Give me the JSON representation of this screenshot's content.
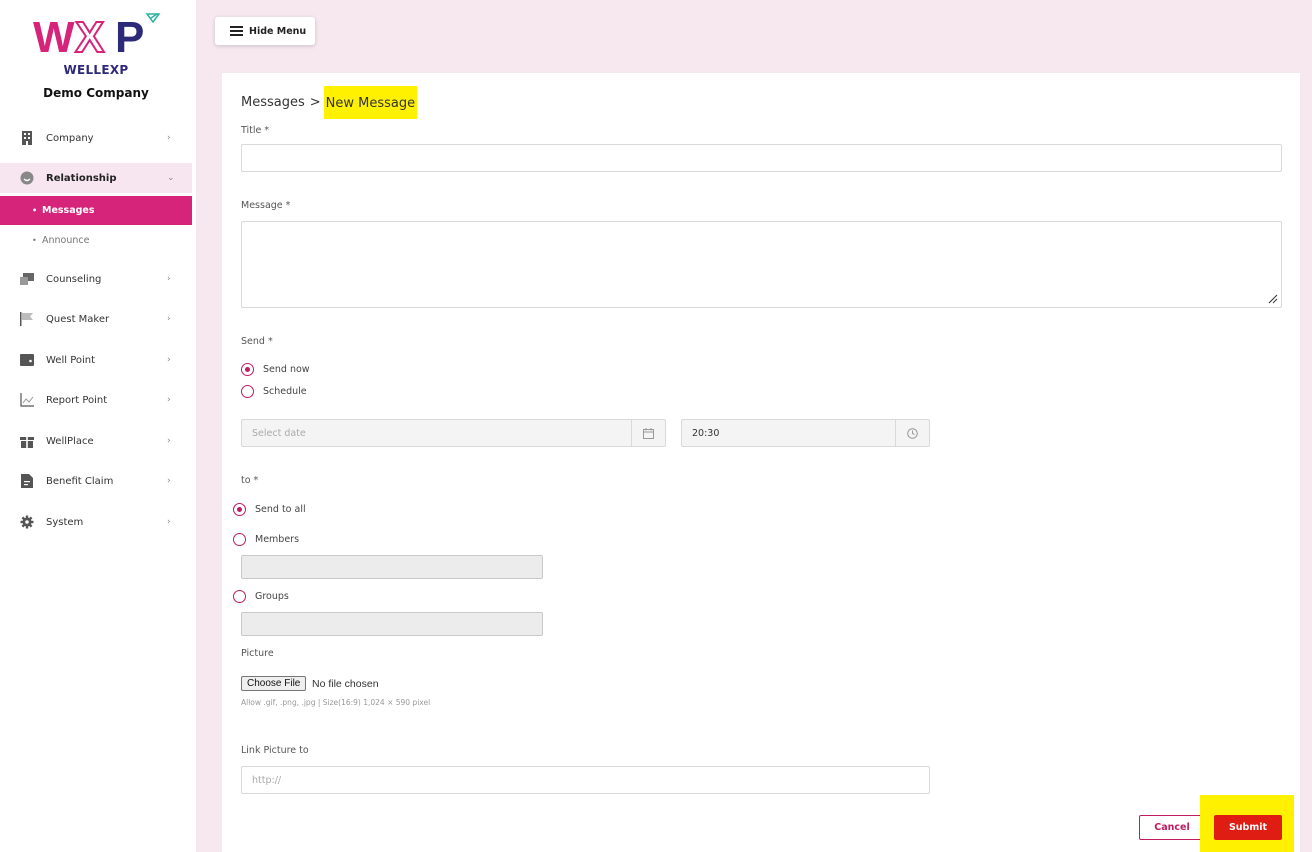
{
  "brand": {
    "logo_text": "WXP",
    "name": "WELLEXP",
    "company": "Demo Company"
  },
  "toolbar": {
    "hide_menu_label": "Hide Menu"
  },
  "sidebar": {
    "items": [
      {
        "label": "Company",
        "icon": "building-icon"
      },
      {
        "label": "Relationship",
        "icon": "relationship-icon"
      },
      {
        "label": "Counseling",
        "icon": "counseling-icon"
      },
      {
        "label": "Quest Maker",
        "icon": "flag-icon"
      },
      {
        "label": "Well Point",
        "icon": "wallet-icon"
      },
      {
        "label": "Report Point",
        "icon": "chart-icon"
      },
      {
        "label": "WellPlace",
        "icon": "gift-icon"
      },
      {
        "label": "Benefit Claim",
        "icon": "document-icon"
      },
      {
        "label": "System",
        "icon": "gear-icon"
      }
    ],
    "sub_items": [
      {
        "label": "Messages"
      },
      {
        "label": "Announce"
      }
    ]
  },
  "breadcrumb": {
    "parent": "Messages",
    "separator": ">",
    "current": "New Message"
  },
  "form": {
    "title_label": "Title *",
    "title_value": "",
    "message_label": "Message *",
    "message_value": "",
    "send_label": "Send *",
    "send_options": [
      "Send now",
      "Schedule"
    ],
    "send_selected": "Send now",
    "date_placeholder": "Select date",
    "time_value": "20:30",
    "to_label": "to *",
    "to_options": [
      "Send to all",
      "Members",
      "Groups"
    ],
    "to_selected": "Send to all",
    "picture_label": "Picture",
    "file_button": "Choose File",
    "file_status": "No file chosen",
    "picture_hint": "Allow .gif, .png, .jpg | Size(16:9) 1,024 × 590 pixel",
    "link_label": "Link Picture to",
    "link_placeholder": "http://"
  },
  "actions": {
    "cancel": "Cancel",
    "submit": "Submit"
  },
  "colors": {
    "primary": "#d6247a",
    "submit": "#e01d12",
    "background": "#f7e8f0",
    "highlight": "#fff100"
  }
}
